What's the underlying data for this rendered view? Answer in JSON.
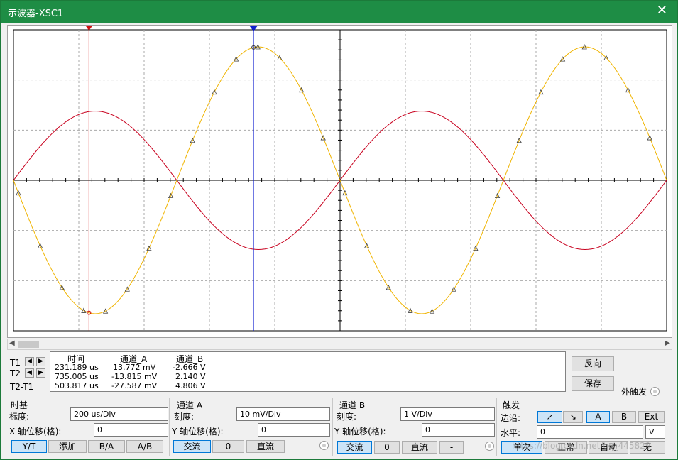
{
  "window": {
    "title": "示波器-XSC1",
    "close_icon": "close-icon"
  },
  "measurements": {
    "headers": [
      "时间",
      "通道_A",
      "通道_B"
    ],
    "rows": [
      {
        "label": "T1",
        "time": "231.189 us",
        "a": "13.772 mV",
        "b": "-2.666 V"
      },
      {
        "label": "T2",
        "time": "735.005 us",
        "a": "-13.815 mV",
        "b": "2.140 V"
      },
      {
        "label": "T2-T1",
        "time": "503.817 us",
        "a": "-27.587 mV",
        "b": "4.806 V"
      }
    ]
  },
  "buttons": {
    "reverse": "反向",
    "save": "保存"
  },
  "ext_trigger_label": "外触发",
  "timebase": {
    "title": "时基",
    "scale_label": "标度:",
    "scale": "200 us/Div",
    "xpos_label": "X 轴位移(格):",
    "xpos": "0",
    "modes": [
      "Y/T",
      "添加",
      "B/A",
      "A/B"
    ]
  },
  "channel_a": {
    "title": "通道 A",
    "scale_label": "刻度:",
    "scale": "10 mV/Div",
    "ypos_label": "Y 轴位移(格):",
    "ypos": "0",
    "coupling": [
      "交流",
      "0",
      "直流"
    ]
  },
  "channel_b": {
    "title": "通道 B",
    "scale_label": "刻度:",
    "scale": "1 V/Div",
    "ypos_label": "Y 轴位移(格):",
    "ypos": "0",
    "coupling": [
      "交流",
      "0",
      "直流",
      "-"
    ]
  },
  "trigger": {
    "title": "触发",
    "edge_label": "边沿:",
    "edge_rise": "↗",
    "edge_fall": "↘",
    "sources": [
      "A",
      "B",
      "Ext"
    ],
    "level_label": "水平:",
    "level": "0",
    "level_unit": "V",
    "modes": [
      "单次",
      "正常",
      "自动",
      "无"
    ]
  },
  "watermark": "https://blog.csdn.net/qq_445829",
  "colors": {
    "title_bar": "#1e8d45",
    "channel_a": "#c8001e",
    "channel_b": "#f0b400",
    "cursor1": "#d01010",
    "cursor2": "#1020d0"
  },
  "chart_data": {
    "type": "line",
    "x": [
      0,
      200,
      400,
      600,
      800,
      1000,
      1200,
      1400,
      1600,
      1800,
      2000
    ],
    "xlabel": "",
    "ylabel": "",
    "xlim": [
      0,
      2000
    ],
    "x_units": "us",
    "time_scale": "200 us/Div",
    "grid": true,
    "series": [
      {
        "scale": "10 mV/Div",
        "values_mV": [
          0,
          13.8,
          0,
          -13.8,
          0,
          13.8,
          0,
          -13.8,
          0,
          13.8,
          0
        ],
        "frequency_hz": 1000,
        "amplitude_mV": 13.8,
        "phase": "sine"
      },
      {
        "scale": "1 V/Div",
        "values_V": [
          0,
          -2.6,
          0,
          2.6,
          0,
          -2.6,
          0,
          2.6,
          0,
          -2.6,
          0
        ],
        "frequency_hz": 1000,
        "amplitude_V": 2.66,
        "phase": "inverted-sine"
      }
    ],
    "cursors": [
      {
        "name": "T1",
        "time_us": 231.189
      },
      {
        "name": "T2",
        "time_us": 735.005
      }
    ]
  }
}
